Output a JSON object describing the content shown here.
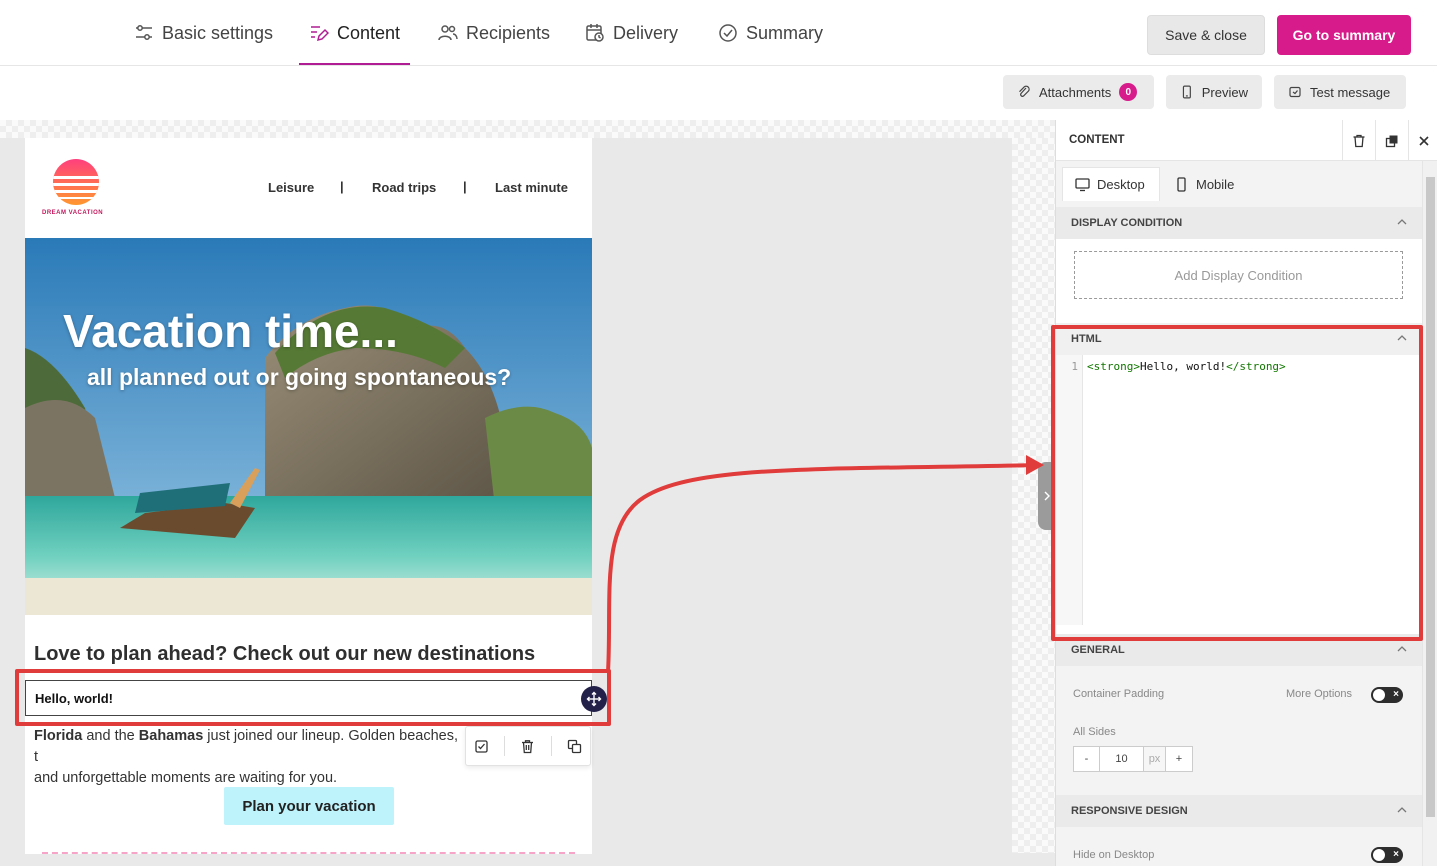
{
  "steps": [
    {
      "label": "Basic settings",
      "icon": "sliders-icon"
    },
    {
      "label": "Content",
      "icon": "edit-content-icon"
    },
    {
      "label": "Recipients",
      "icon": "users-icon"
    },
    {
      "label": "Delivery",
      "icon": "calendar-clock-icon"
    },
    {
      "label": "Summary",
      "icon": "check-circle-icon"
    }
  ],
  "actions": {
    "save_close": "Save & close",
    "go_summary": "Go to summary"
  },
  "toolbar": {
    "attachments": "Attachments",
    "attachments_count": "0",
    "preview": "Preview",
    "test_message": "Test message"
  },
  "email": {
    "logo_text": "DREAM VACATION",
    "menu": [
      "Leisure",
      "Road trips",
      "Last minute"
    ],
    "separator": "|",
    "hero_title": "Vacation time...",
    "hero_subtitle": "all planned out or going spontaneous?",
    "heading": "Love to plan ahead? Check out our new destinations",
    "html_block": "Hello, world!",
    "para_bold1": "Florida",
    "para_text1": " and the ",
    "para_bold2": "Bahamas",
    "para_text2": " just joined our lineup. Golden beaches, t",
    "para_text3": "and unforgettable moments are waiting for you.",
    "cta": "Plan your vacation"
  },
  "panel": {
    "title": "CONTENT",
    "tabs": [
      "Desktop",
      "Mobile"
    ],
    "display_condition": {
      "header": "DISPLAY CONDITION",
      "button": "Add Display Condition"
    },
    "html": {
      "header": "HTML",
      "line_no": "1",
      "tag_open": "<strong>",
      "text": "Hello, world!",
      "tag_close": "</strong>"
    },
    "general": {
      "header": "GENERAL",
      "container_padding": "Container Padding",
      "more_options": "More Options",
      "all_sides": "All Sides",
      "minus": "-",
      "value": "10",
      "unit": "px",
      "plus": "+"
    },
    "responsive": {
      "header": "RESPONSIVE DESIGN",
      "hide_desktop": "Hide on Desktop"
    }
  },
  "colors": {
    "accent": "#d81b8a",
    "highlight": "#e03c3c",
    "cta_bg": "#bff3fb"
  }
}
